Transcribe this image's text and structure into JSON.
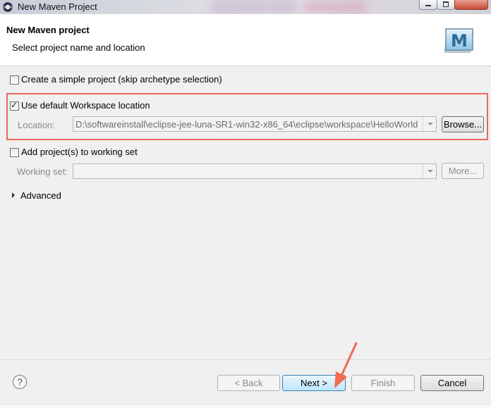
{
  "window": {
    "title": "New Maven Project"
  },
  "header": {
    "title": "New Maven project",
    "description": "Select project name and location",
    "logo_letter": "M"
  },
  "options": {
    "simple_project_label": "Create a simple project (skip archetype selection)",
    "simple_project_checked": false,
    "default_workspace_label": "Use default Workspace location",
    "default_workspace_checked": true,
    "location_label": "Location:",
    "location_value": "D:\\softwareinstall\\eclipse-jee-luna-SR1-win32-x86_64\\eclipse\\workspace\\HelloWorld",
    "browse_label": "Browse...",
    "working_set_checkbox_label": "Add project(s) to working set",
    "working_set_checked": false,
    "working_set_label": "Working set:",
    "working_set_value": "",
    "more_label": "More...",
    "advanced_label": "Advanced"
  },
  "footer": {
    "back_label": "< Back",
    "next_label": "Next >",
    "finish_label": "Finish",
    "cancel_label": "Cancel"
  },
  "colors": {
    "highlight": "#e8695a",
    "annotation_arrow": "#f26a4f"
  },
  "icons": [
    "eclipse-app-icon",
    "maven-logo-icon",
    "help-icon",
    "chevron-right-icon",
    "combo-arrow-icon"
  ]
}
